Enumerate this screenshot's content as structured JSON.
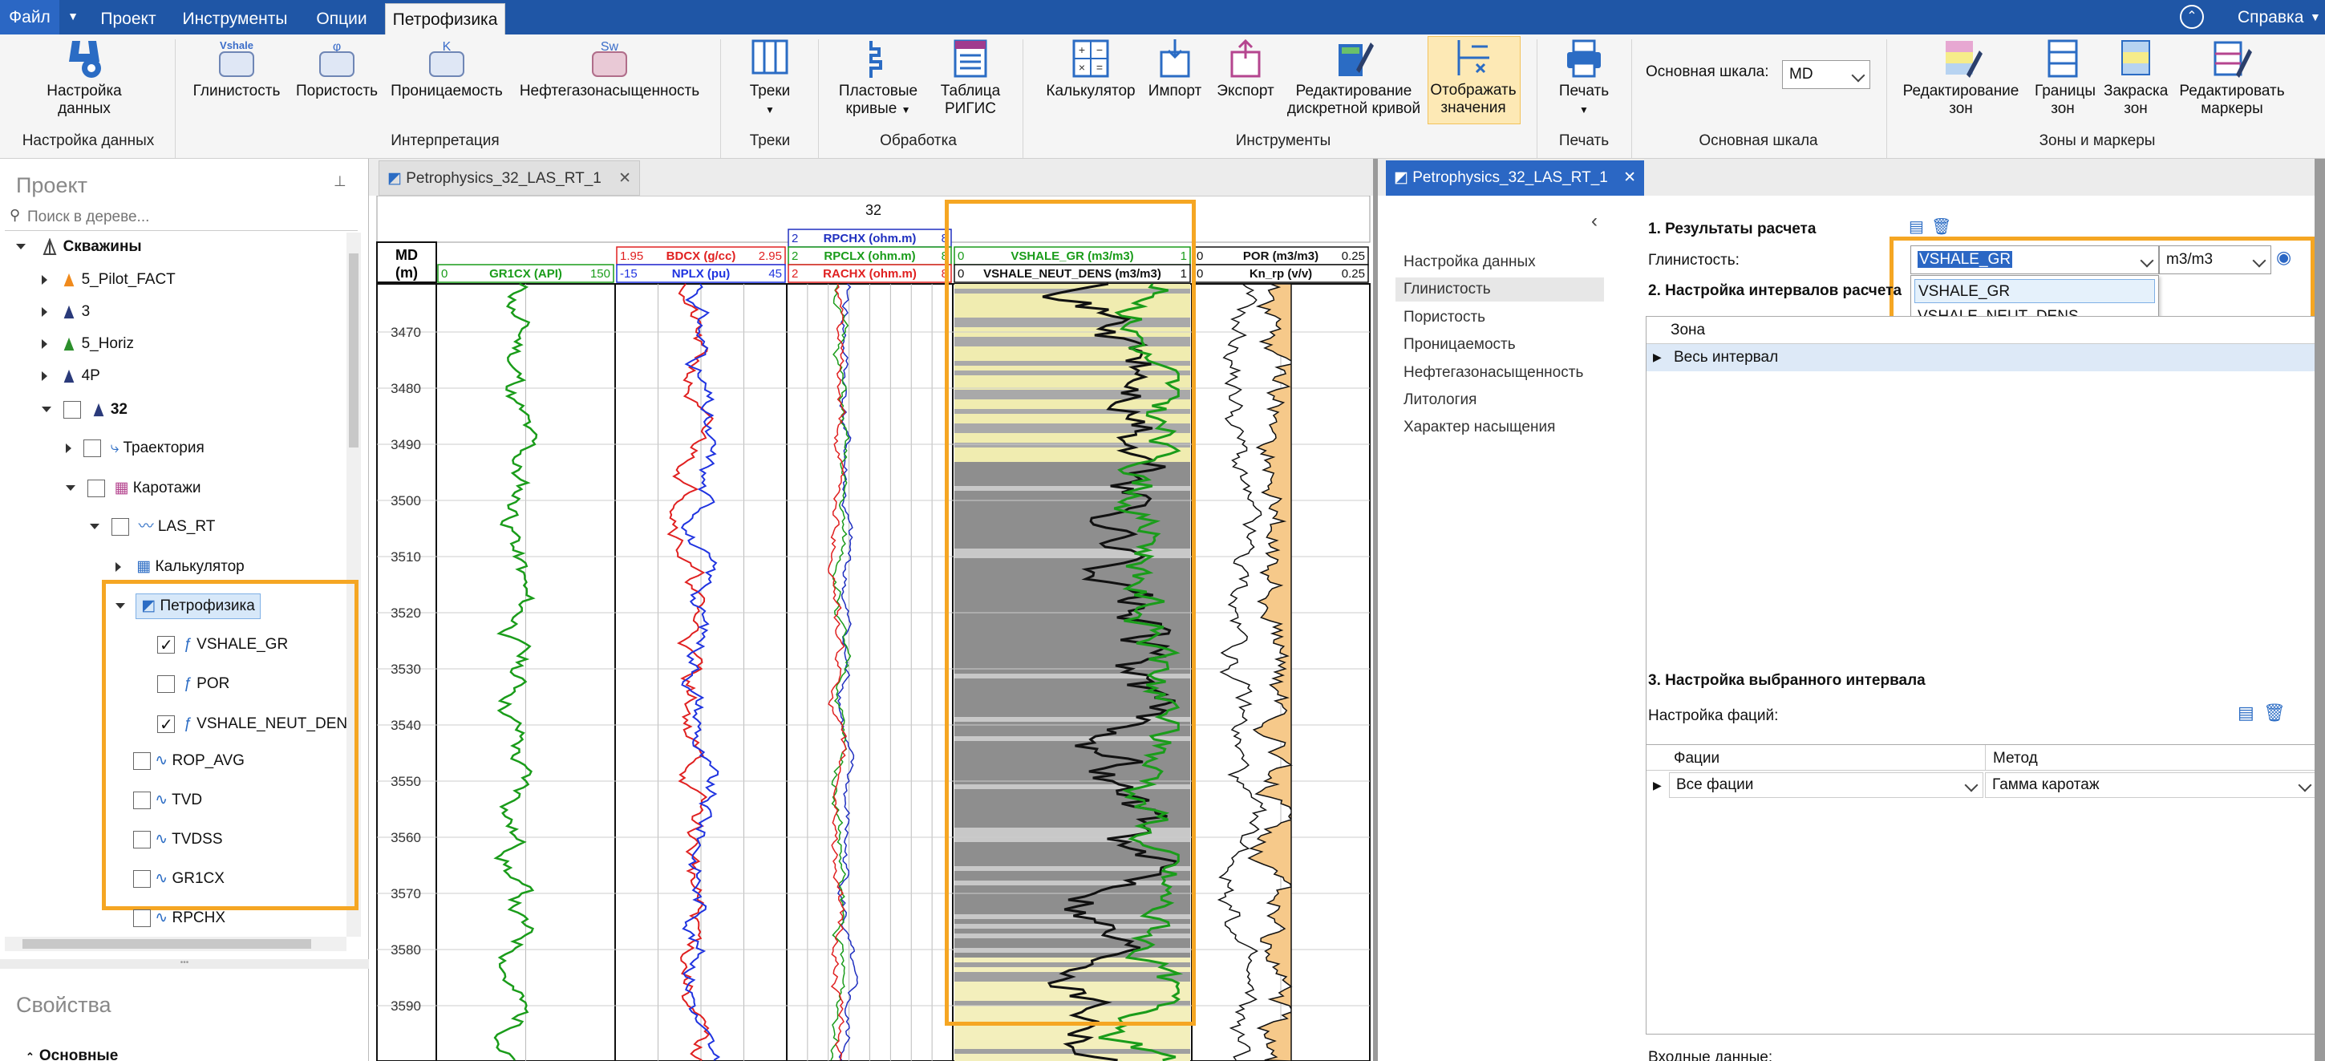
{
  "menu": {
    "file": "Файл",
    "tabs": [
      "Проект",
      "Инструменты",
      "Опции",
      "Петрофизика"
    ],
    "help": "Справка"
  },
  "ribbon": {
    "data_setup": "Настройка данных",
    "data_setup_group": "Настройка данных",
    "interp": [
      "Глинистость",
      "Пористость",
      "Проницаемость",
      "Нефтегазонасыщенность"
    ],
    "interp_icons": [
      "Vshale",
      "φ",
      "K",
      "Sw"
    ],
    "interp_group": "Интерпретация",
    "tracks": "Треки",
    "tracks_group": "Треки",
    "processing": [
      "Пластовые кривые",
      "Таблица РИГИС"
    ],
    "processing_group": "Обработка",
    "tools": [
      "Калькулятор",
      "Импорт",
      "Экспорт",
      "Редактирование дискретной кривой",
      "Отображать значения"
    ],
    "tools_group": "Инструменты",
    "print": "Печать",
    "print_group": "Печать",
    "base_scale_label": "Основная шкала:",
    "base_scale_value": "MD",
    "base_scale_group": "Основная шкала",
    "zones": [
      "Редактирование зон",
      "Границы зон",
      "Закраска зон",
      "Редактировать маркеры"
    ],
    "zones_group": "Зоны и маркеры"
  },
  "project": {
    "title": "Проект",
    "search_placeholder": "Поиск в дереве...",
    "wells_root": "Скважины",
    "wells": [
      "5_Pilot_FACT",
      "3",
      "5_Horiz",
      "4P",
      "32"
    ],
    "trajectory": "Траектория",
    "logs": "Каротажи",
    "las": "LAS_RT",
    "calculator": "Калькулятор",
    "petrophysics": "Петрофизика",
    "petro_children": [
      {
        "name": "VSHALE_GR",
        "checked": true
      },
      {
        "name": "POR",
        "checked": false
      },
      {
        "name": "VSHALE_NEUT_DEN",
        "checked": true
      }
    ],
    "curves": [
      "ROP_AVG",
      "TVD",
      "TVDSS",
      "GR1CX",
      "RPCHX"
    ],
    "properties_title": "Свойства",
    "properties_section": "Основные"
  },
  "center": {
    "tab_title": "Petrophysics_32_LAS_RT_1",
    "well_header": "32",
    "depth_header": "MD (m)",
    "tracks": [
      {
        "curves": [
          {
            "name": "GR1CX (API)",
            "min": "0",
            "max": "150",
            "color": "#1a9c1a"
          }
        ]
      },
      {
        "curves": [
          {
            "name": "BDCX (g/cc)",
            "min": "1.95",
            "max": "2.95",
            "color": "#e02020"
          },
          {
            "name": "NPLX (pu)",
            "min": "-15",
            "max": "45",
            "color": "#1f33e0"
          }
        ]
      },
      {
        "curves": [
          {
            "name": "RPCHX (ohm.m)",
            "min": "2",
            "max": "8",
            "color": "#2030c0"
          },
          {
            "name": "RPCLX (ohm.m)",
            "min": "2",
            "max": "8",
            "color": "#1a9c1a"
          },
          {
            "name": "RACHX (ohm.m)",
            "min": "2",
            "max": "8",
            "color": "#e02020"
          }
        ]
      },
      {
        "curves": [
          {
            "name": "VSHALE_GR (m3/m3)",
            "min": "0",
            "max": "1",
            "color": "#1a9c1a"
          },
          {
            "name": "VSHALE_NEUT_DENS (m3/m3)",
            "min": "0",
            "max": "1",
            "color": "#111"
          }
        ]
      },
      {
        "curves": [
          {
            "name": "POR (m3/m3)",
            "min": "0",
            "max": "0.25",
            "color": "#111"
          },
          {
            "name": "Kn_rp (v/v)",
            "min": "0",
            "max": "0.25",
            "color": "#111"
          }
        ]
      }
    ],
    "depths": [
      "3470",
      "3480",
      "3490",
      "3500",
      "3510",
      "3520",
      "3530",
      "3540",
      "3550",
      "3560",
      "3570",
      "3580",
      "3590"
    ]
  },
  "right": {
    "tab_title": "Petrophysics_32_LAS_RT_1",
    "nav": [
      "Настройка данных",
      "Глинистость",
      "Пористость",
      "Проницаемость",
      "Нефтегазонасыщенность",
      "Литология",
      "Характер насыщения"
    ],
    "nav_selected": 1,
    "s1_title": "1. Результаты расчета",
    "shale_label": "Глинистость:",
    "shale_value": "VSHALE_GR",
    "unit_value": "m3/m3",
    "dropdown_options": [
      "VSHALE_GR",
      "VSHALE_NEUT_DENS"
    ],
    "s2_title": "2. Настройка интервалов расчета",
    "zone_col": "Зона",
    "zone_row": "Весь интервал",
    "s3_title": "3. Настройка выбранного интервала",
    "facies_label": "Настройка фаций:",
    "facies_col": "Фации",
    "method_col": "Метод",
    "facies_value": "Все фации",
    "method_value": "Гамма каротаж",
    "input_label": "Входные данные:"
  }
}
